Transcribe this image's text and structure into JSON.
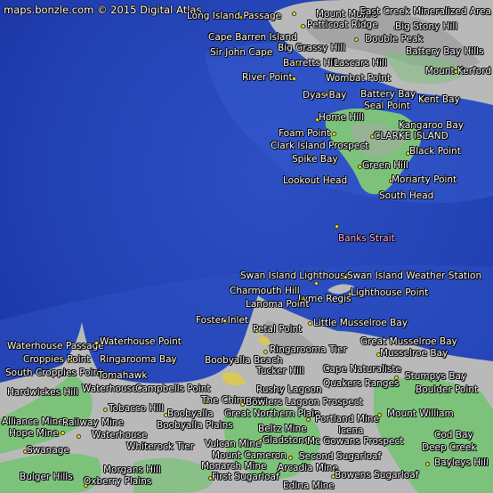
{
  "credit": "maps.bonzle.com © 2015 Digital Atlas",
  "colors": {
    "sea_deep": "#1a2fa0",
    "sea_shallow": "#2f55c8",
    "land_green": "#7cc27a",
    "land_grey": "#b9b9b9",
    "label_text": "#ffffff",
    "highlight_text": "#ffb3ff",
    "marker": "#ffe800"
  },
  "places": [
    {
      "label": "Long Island Passage"
    },
    {
      "label": "Mount Munro"
    },
    {
      "label": "East Creek Mineralized Area"
    },
    {
      "label": "Petticoat Ridge"
    },
    {
      "label": "Big Stony Hill"
    },
    {
      "label": "Cape Barren Island"
    },
    {
      "label": "Double Peak"
    },
    {
      "label": "Big Grassy Hill"
    },
    {
      "label": "Sir John Cape"
    },
    {
      "label": "Battery Bay Hills"
    },
    {
      "label": "Barretts Hill"
    },
    {
      "label": "Lascars Hill"
    },
    {
      "label": "Mount Kerford"
    },
    {
      "label": "River Point"
    },
    {
      "label": "Wombat Point"
    },
    {
      "label": "Dyas Bay"
    },
    {
      "label": "Battery Bay"
    },
    {
      "label": "Kent Bay"
    },
    {
      "label": "Seal Point"
    },
    {
      "label": "Home Hill"
    },
    {
      "label": "Kangaroo Bay"
    },
    {
      "label": "Foam Point"
    },
    {
      "label": "CLARKE ISLAND"
    },
    {
      "label": "Clark Island Prospect"
    },
    {
      "label": "Black Point"
    },
    {
      "label": "Spike Bay"
    },
    {
      "label": "Green Hill"
    },
    {
      "label": "Lookout Head"
    },
    {
      "label": "Moriarty Point"
    },
    {
      "label": "South Head"
    },
    {
      "label": "Banks Strait",
      "highlight": true
    },
    {
      "label": "Swan Island Lighthouse"
    },
    {
      "label": "Swan Island Weather Station"
    },
    {
      "label": "Charmouth Hill"
    },
    {
      "label": "Lyme Regis"
    },
    {
      "label": "Lighthouse Point"
    },
    {
      "label": "Lanoma Point"
    },
    {
      "label": "Foster Inlet"
    },
    {
      "label": "Little Musselroe Bay"
    },
    {
      "label": "Petal Point"
    },
    {
      "label": "Waterhouse Passage"
    },
    {
      "label": "Waterhouse Point"
    },
    {
      "label": "Great Musselroe Bay"
    },
    {
      "label": "Croppies Point"
    },
    {
      "label": "Ringarooma Tier"
    },
    {
      "label": "Musselroe Bay"
    },
    {
      "label": "Ringarooma Bay"
    },
    {
      "label": "Boobyalla Beach"
    },
    {
      "label": "South Croppies Point"
    },
    {
      "label": "Tomahawk"
    },
    {
      "label": "Tucker Hill"
    },
    {
      "label": "Cape Naturaliste"
    },
    {
      "label": "Stumpys Bay"
    },
    {
      "label": "Quakers Ranges"
    },
    {
      "label": "Hardwickes Hill"
    },
    {
      "label": "Waterhouse"
    },
    {
      "label": "Campbells Point"
    },
    {
      "label": "Rushy Lagoon"
    },
    {
      "label": "Boulder Point"
    },
    {
      "label": "The Chimneys"
    },
    {
      "label": "Bowlers Lagoon Prospect"
    },
    {
      "label": "Tobacco Hill"
    },
    {
      "label": "Boobyalla"
    },
    {
      "label": "Great Northern Plain"
    },
    {
      "label": "Portland Mine"
    },
    {
      "label": "Mount William"
    },
    {
      "label": "Alliance Mine"
    },
    {
      "label": "Railway Mine"
    },
    {
      "label": "Hope Mine"
    },
    {
      "label": "Boobyalla Plains"
    },
    {
      "label": "Beltz Mine"
    },
    {
      "label": "Icena"
    },
    {
      "label": "Waterhouse"
    },
    {
      "label": "Gladstone"
    },
    {
      "label": "Mc Gowans Prospect"
    },
    {
      "label": "Cod Bay"
    },
    {
      "label": "Whiterock Tier"
    },
    {
      "label": "Vulcan Mine"
    },
    {
      "label": "Deep Creek"
    },
    {
      "label": "Swanage"
    },
    {
      "label": "Mount Cameron"
    },
    {
      "label": "Second Sugarloaf"
    },
    {
      "label": "Monarch Mine"
    },
    {
      "label": "Bayleys Hill"
    },
    {
      "label": "Morgans Hill"
    },
    {
      "label": "Arcadia Mine"
    },
    {
      "label": "Bulger Hills"
    },
    {
      "label": "First Sugarloaf"
    },
    {
      "label": "Bowens Sugarloaf"
    },
    {
      "label": "Oxberry Plains"
    },
    {
      "label": "Edina Mine"
    }
  ]
}
